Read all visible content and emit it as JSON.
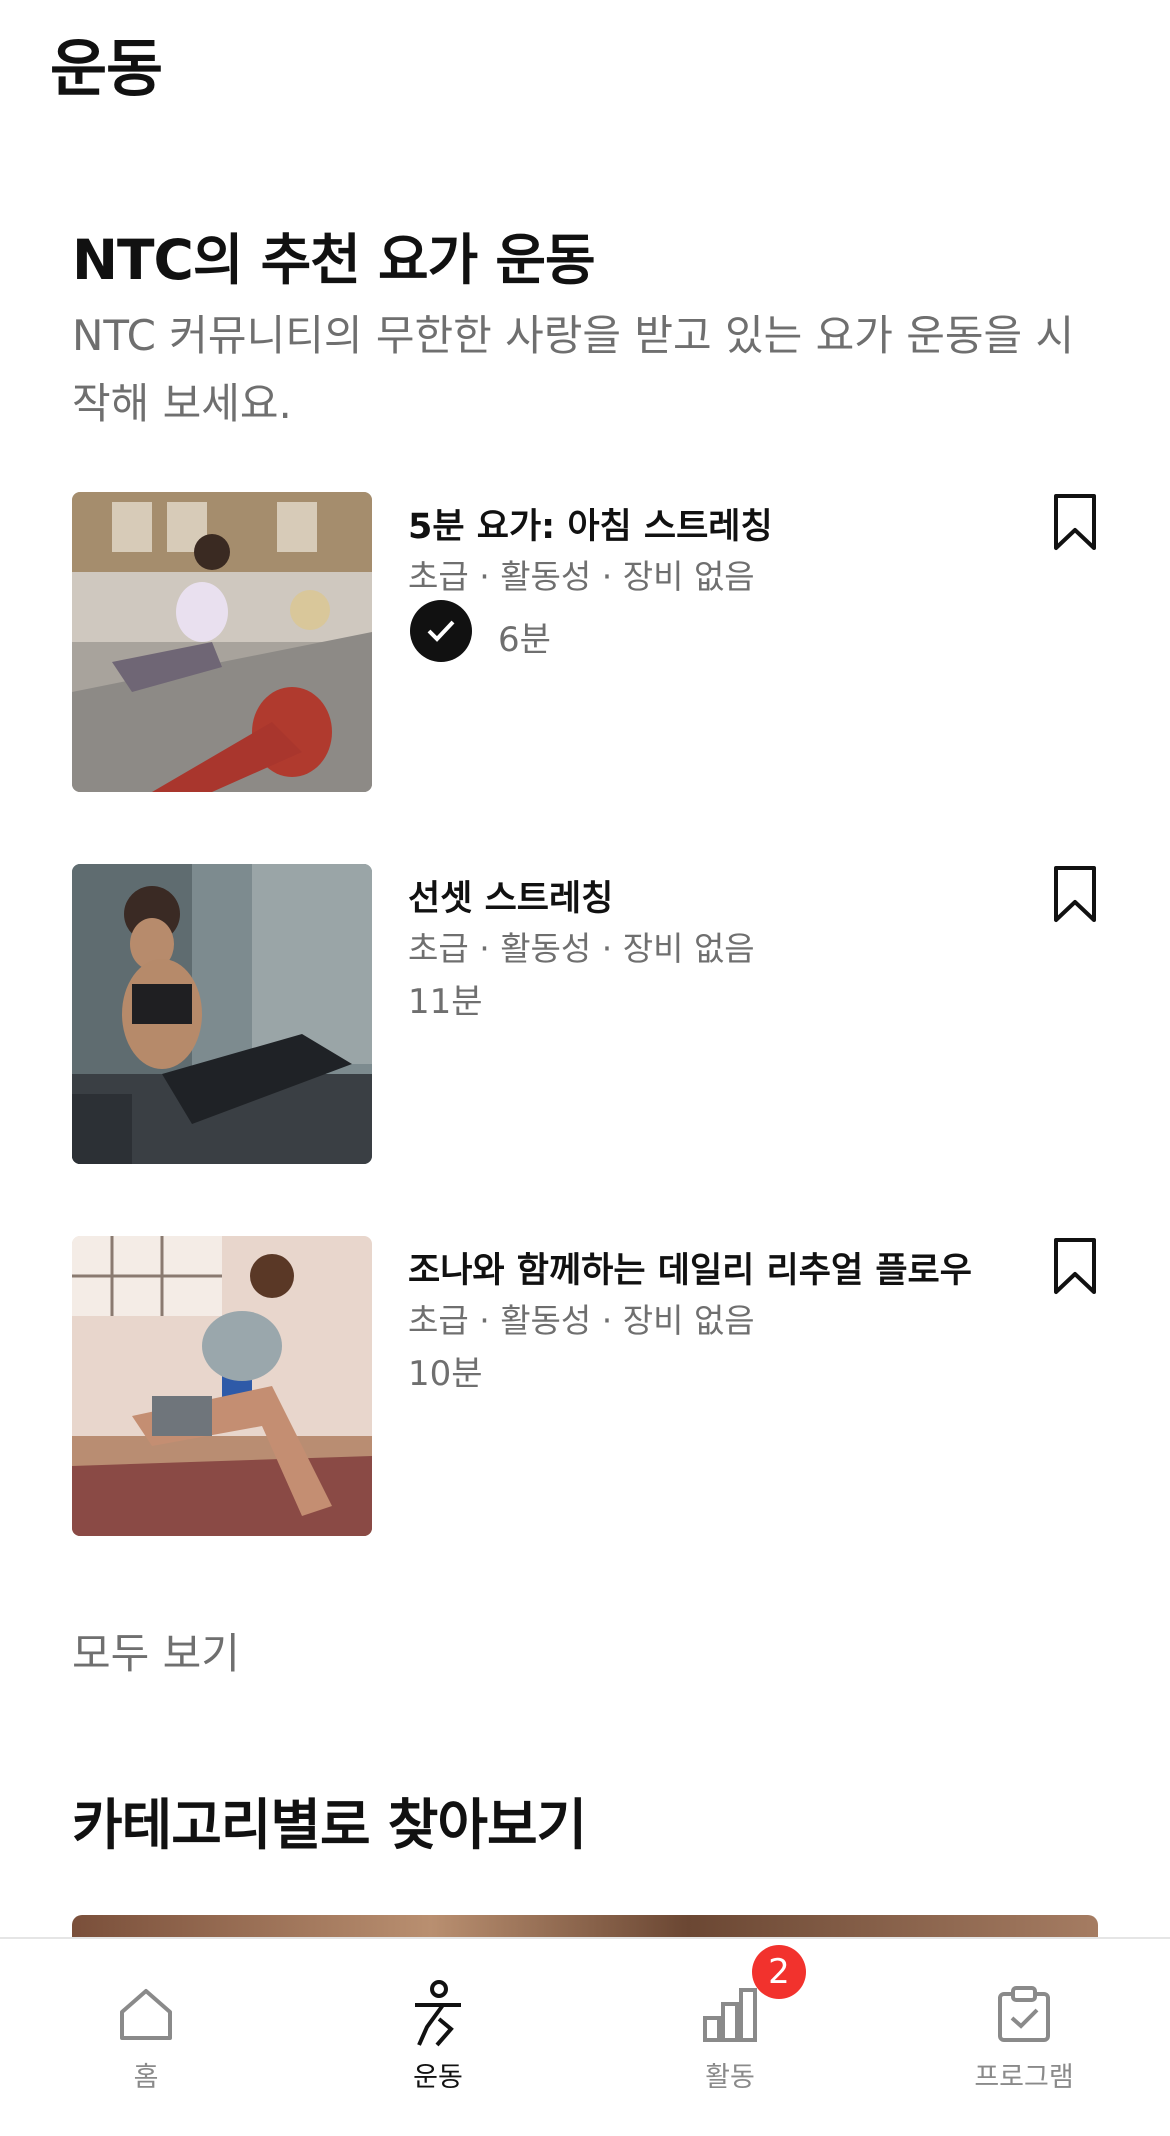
{
  "header": {
    "title": "운동"
  },
  "section": {
    "title": "NTC의 추천 요가 운동",
    "subtitle": "NTC 커뮤니티의 무한한 사랑을 받고 있는 요가 운동을 시작해 보세요."
  },
  "workouts": [
    {
      "title": "5분 요가: 아침 스트레칭",
      "meta": "초급 · 활동성 · 장비 없음",
      "duration": "6분",
      "completed": true
    },
    {
      "title": "선셋 스트레칭",
      "meta": "초급 · 활동성 · 장비 없음",
      "duration": "11분",
      "completed": false
    },
    {
      "title": "조나와 함께하는 데일리 리추얼 플로우",
      "meta": "초급 · 활동성 · 장비 없음",
      "duration": "10분",
      "completed": false
    }
  ],
  "see_all": "모두 보기",
  "category": {
    "title": "카테고리별로 찾아보기"
  },
  "tabs": [
    {
      "label": "홈",
      "icon": "home-icon",
      "active": false
    },
    {
      "label": "운동",
      "icon": "running-figure-icon",
      "active": true
    },
    {
      "label": "활동",
      "icon": "bar-chart-icon",
      "active": false,
      "badge": "2"
    },
    {
      "label": "프로그램",
      "icon": "clipboard-check-icon",
      "active": false
    }
  ],
  "colors": {
    "badge": "#f2322d",
    "text_primary": "#111111",
    "text_secondary": "#6f6f6f"
  }
}
